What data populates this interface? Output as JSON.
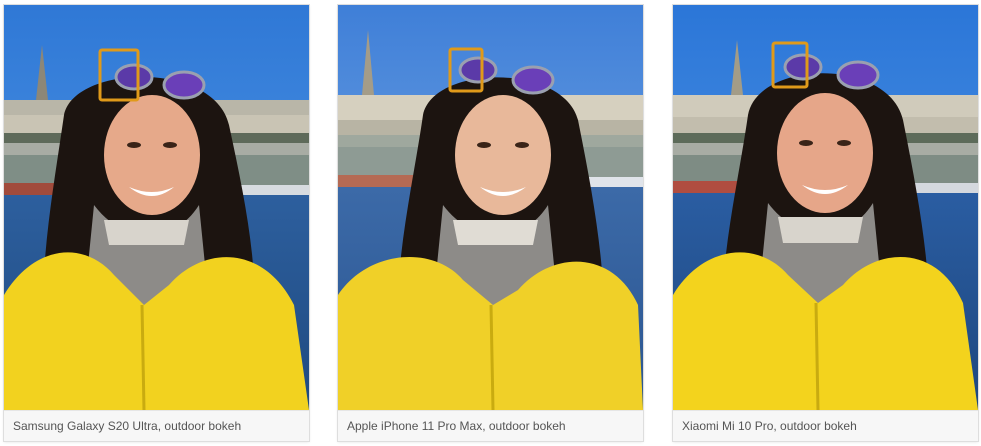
{
  "gallery": {
    "items": [
      {
        "caption": "Samsung Galaxy S20 Ultra, outdoor bokeh",
        "highlight_color": "#e09a1a"
      },
      {
        "caption": "Apple iPhone 11 Pro Max, outdoor bokeh",
        "highlight_color": "#e09a1a"
      },
      {
        "caption": "Xiaomi Mi 10 Pro, outdoor bokeh",
        "highlight_color": "#e09a1a"
      }
    ]
  },
  "colors": {
    "sky": "#3a7bd5",
    "water": "#2a5aa0",
    "jacket": "#f2d21f",
    "hair": "#1c1410",
    "caption_bg": "#f7f7f7",
    "caption_text": "#555555"
  }
}
